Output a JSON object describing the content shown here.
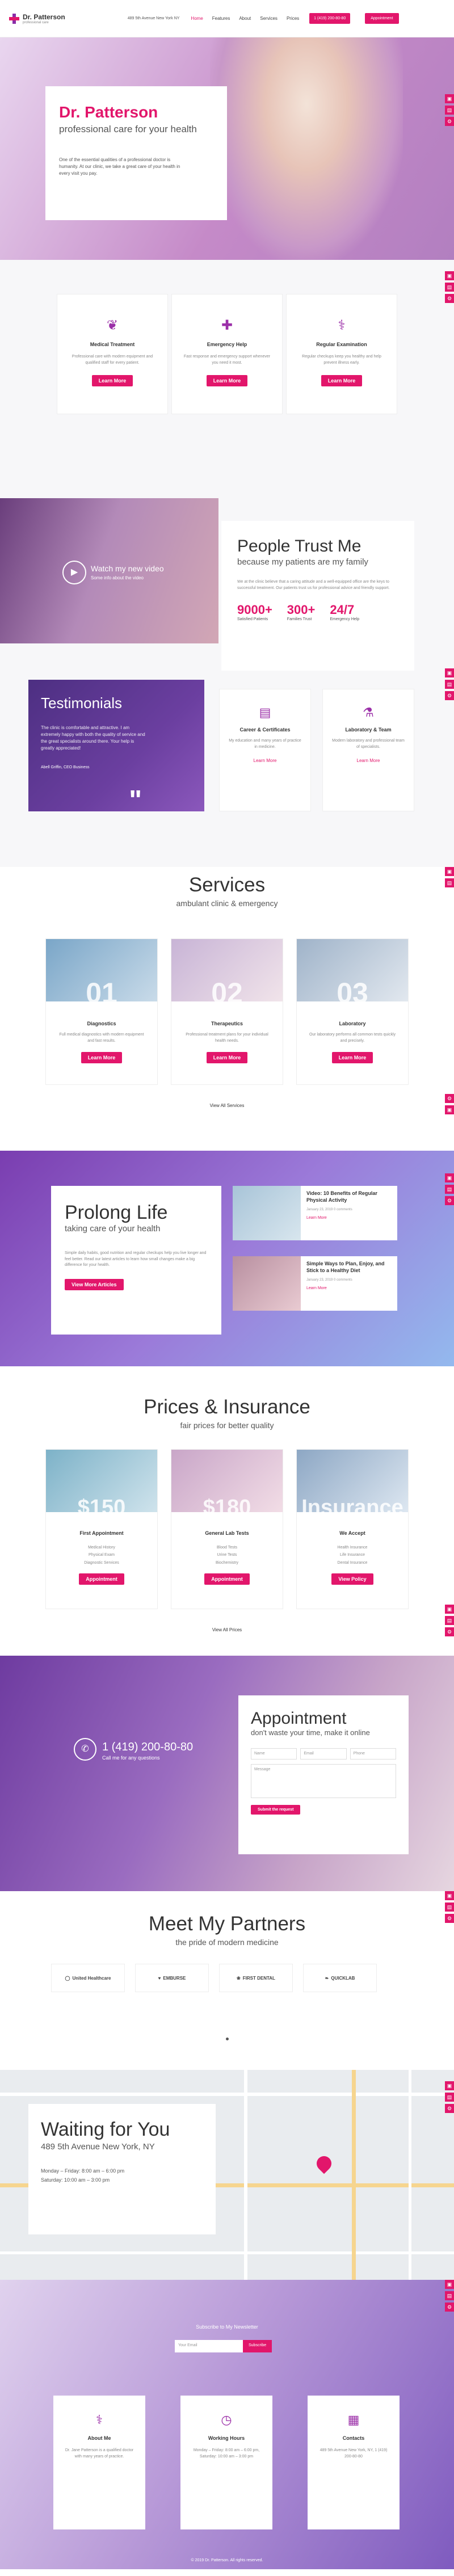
{
  "header": {
    "brand": "Dr. Patterson",
    "brand_sub": "professional care",
    "address": "489 5th Avenue New York NY",
    "nav": [
      "Home",
      "Features",
      "About",
      "Services",
      "Prices"
    ],
    "phone": "1 (419) 200-80-80",
    "appointment": "Appointment"
  },
  "hero": {
    "title": "Dr. Patterson",
    "subtitle": "professional care for your health",
    "text": "One of the essential qualities of a professional doctor is humanity. At our clinic, we take a great care of your health in every visit you pay."
  },
  "features": [
    {
      "icon": "plant-icon",
      "glyph": "❦",
      "title": "Medical Treatment",
      "text": "Professional care with modern equipment and qualified staff for every patient.",
      "button": "Learn More"
    },
    {
      "icon": "first-aid-icon",
      "glyph": "✚",
      "title": "Emergency Help",
      "text": "Fast response and emergency support whenever you need it most.",
      "button": "Learn More"
    },
    {
      "icon": "stethoscope-icon",
      "glyph": "⚕",
      "title": "Regular Examination",
      "text": "Regular checkups keep you healthy and help prevent illness early.",
      "button": "Learn More"
    }
  ],
  "trust": {
    "video_title": "Watch my new video",
    "video_sub": "Some info about the video",
    "title": "People Trust Me",
    "subtitle": "because my patients are my family",
    "text": "We at the clinic believe that a caring attitude and a well-equipped office are the keys to successful treatment. Our patients trust us for professional advice and friendly support.",
    "stats": [
      {
        "num": "9000+",
        "label": "Satisfied Patients"
      },
      {
        "num": "300+",
        "label": "Families Trust"
      },
      {
        "num": "24/7",
        "label": "Emergency Help"
      }
    ],
    "testimonials_title": "Testimonials",
    "testimonial_text": "The clinic is comfortable and attractive. I am extremely happy with both the quality of service and the great specialists around there. Your help is greatly appreciated!",
    "testimonial_author": "Abell Griffin, CEO Business",
    "cards": [
      {
        "icon": "certificate-icon",
        "glyph": "▤",
        "title": "Career & Certificates",
        "text": "My education and many years of practice in medicine.",
        "more": "Learn More"
      },
      {
        "icon": "lab-icon",
        "glyph": "⚗",
        "title": "Laboratory & Team",
        "text": "Modern laboratory and professional team of specialists.",
        "more": "Learn More"
      }
    ]
  },
  "services": {
    "title": "Services",
    "subtitle": "ambulant clinic & emergency",
    "items": [
      {
        "num": "01",
        "title": "Diagnostics",
        "text": "Full medical diagnostics with modern equipment and fast results.",
        "button": "Learn More"
      },
      {
        "num": "02",
        "title": "Therapeutics",
        "text": "Professional treatment plans for your individual health needs.",
        "button": "Learn More"
      },
      {
        "num": "03",
        "title": "Laboratory",
        "text": "Our laboratory performs all common tests quickly and precisely.",
        "button": "Learn More"
      }
    ],
    "view_all": "View All Services"
  },
  "prolong": {
    "title": "Prolong Life",
    "subtitle": "taking care of your health",
    "text": "Simple daily habits, good nutrition and regular checkups help you live longer and feel better. Read our latest articles to learn how small changes make a big difference for your health.",
    "button": "View More Articles",
    "news": [
      {
        "title": "Video: 10 Benefits of Regular Physical Activity",
        "meta": "January 23, 2019    0 comments",
        "more": "Learn More"
      },
      {
        "title": "Simple Ways to Plan, Enjoy, and Stick to a Healthy Diet",
        "meta": "January 23, 2019    0 comments",
        "more": "Learn More"
      }
    ]
  },
  "prices": {
    "title": "Prices & Insurance",
    "subtitle": "fair prices for better quality",
    "items": [
      {
        "num": "$150",
        "title": "First Appointment",
        "list": [
          "Medical History",
          "Physical Exam",
          "Diagnostic Services"
        ],
        "button": "Appointment"
      },
      {
        "num": "$180",
        "title": "General Lab Tests",
        "list": [
          "Blood Tests",
          "Urine Tests",
          "Biochemistry"
        ],
        "button": "Appointment"
      },
      {
        "num": "Insurance",
        "title": "We Accept",
        "list": [
          "Health Insurance",
          "Life Insurance",
          "Dental Insurance"
        ],
        "button": "View Policy"
      }
    ],
    "view_all": "View All Prices"
  },
  "appointment": {
    "phone": "1 (419) 200-80-80",
    "phone_sub": "Call me for any questions",
    "title": "Appointment",
    "subtitle": "don't waste your time, make it online",
    "fields": [
      "Name",
      "Email",
      "Phone"
    ],
    "message": "Message",
    "button": "Submit the request"
  },
  "partners": {
    "title": "Meet My Partners",
    "subtitle": "the pride of modern medicine",
    "logos": [
      {
        "icon": "circle-icon",
        "glyph": "◯",
        "name": "United Healthcare"
      },
      {
        "icon": "heart-icon",
        "glyph": "♥",
        "name": "EMBURSE"
      },
      {
        "icon": "tooth-icon",
        "glyph": "❀",
        "name": "FIRST DENTAL"
      },
      {
        "icon": "leaf-icon",
        "glyph": "❧",
        "name": "QUICKLAB"
      }
    ]
  },
  "map": {
    "title": "Waiting for You",
    "address": "489 5th Avenue New York, NY",
    "hours1": "Monday – Friday: 8:00 am – 6:00 pm",
    "hours2": "Saturday: 10:00 am – 3:00 pm"
  },
  "footer": {
    "newsletter_label": "Subscribe to My Newsletter",
    "newsletter_placeholder": "Your Email",
    "newsletter_button": "Subscribe",
    "columns": [
      {
        "icon": "doctor-icon",
        "glyph": "⚕",
        "title": "About Me",
        "text": "Dr. Jane Patterson is a qualified doctor with many years of practice."
      },
      {
        "icon": "clock-icon",
        "glyph": "◷",
        "title": "Working Hours",
        "text": "Monday – Friday: 8:00 am – 6:00 pm, Saturday: 10:00 am – 3:00 pm"
      },
      {
        "icon": "hospital-icon",
        "glyph": "▦",
        "title": "Contacts",
        "text": "489 5th Avenue New York, NY, 1 (419) 200-80-80"
      }
    ],
    "copyright": "© 2019 Dr. Patterson. All rights reserved."
  },
  "colors": {
    "accent": "#e2166b",
    "purple": "#8a2ca8"
  }
}
